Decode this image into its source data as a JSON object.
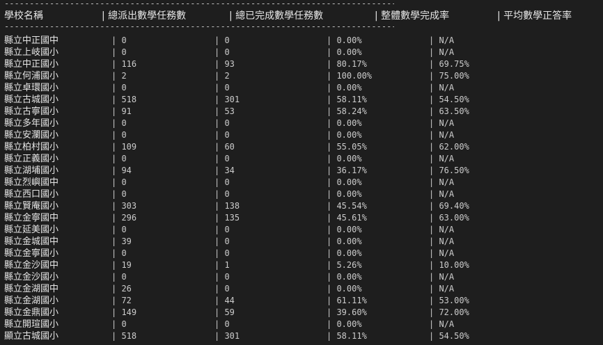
{
  "rule_top": "----------------------------------------------------------------------------------",
  "rule_bottom": "----------------------------------------------------------------------------------",
  "headers": {
    "school": "學校名稱",
    "assigned": "| 總派出數學任務數",
    "completed": "| 總已完成數學任務數",
    "completion_rate": "| 整體數學完成率",
    "accuracy": "| 平均數學正答率"
  },
  "rows": [
    {
      "school": "縣立中正國中",
      "assigned": "| 0",
      "completed": "| 0",
      "completion_rate": "| 0.00%",
      "accuracy": "| N/A"
    },
    {
      "school": "縣立上岐國小",
      "assigned": "| 0",
      "completed": "| 0",
      "completion_rate": "| 0.00%",
      "accuracy": "| N/A"
    },
    {
      "school": "縣立中正國小",
      "assigned": "| 116",
      "completed": "| 93",
      "completion_rate": "| 80.17%",
      "accuracy": "| 69.75%"
    },
    {
      "school": "縣立何浦國小",
      "assigned": "| 2",
      "completed": "| 2",
      "completion_rate": "| 100.00%",
      "accuracy": "| 75.00%"
    },
    {
      "school": "縣立卓環國小",
      "assigned": "| 0",
      "completed": "| 0",
      "completion_rate": "| 0.00%",
      "accuracy": "| N/A"
    },
    {
      "school": "縣立古城國小",
      "assigned": "| 518",
      "completed": "| 301",
      "completion_rate": "| 58.11%",
      "accuracy": "| 54.50%"
    },
    {
      "school": "縣立古寧國小",
      "assigned": "| 91",
      "completed": "| 53",
      "completion_rate": "| 58.24%",
      "accuracy": "| 63.50%"
    },
    {
      "school": "縣立多年國小",
      "assigned": "| 0",
      "completed": "| 0",
      "completion_rate": "| 0.00%",
      "accuracy": "| N/A"
    },
    {
      "school": "縣立安瀾國小",
      "assigned": "| 0",
      "completed": "| 0",
      "completion_rate": "| 0.00%",
      "accuracy": "| N/A"
    },
    {
      "school": "縣立柏村國小",
      "assigned": "| 109",
      "completed": "| 60",
      "completion_rate": "| 55.05%",
      "accuracy": "| 62.00%"
    },
    {
      "school": "縣立正義國小",
      "assigned": "| 0",
      "completed": "| 0",
      "completion_rate": "| 0.00%",
      "accuracy": "| N/A"
    },
    {
      "school": "縣立湖埔國小",
      "assigned": "| 94",
      "completed": "| 34",
      "completion_rate": "| 36.17%",
      "accuracy": "| 76.50%"
    },
    {
      "school": "縣立烈嶼國中",
      "assigned": "| 0",
      "completed": "| 0",
      "completion_rate": "| 0.00%",
      "accuracy": "| N/A"
    },
    {
      "school": "縣立西口國小",
      "assigned": "| 0",
      "completed": "| 0",
      "completion_rate": "| 0.00%",
      "accuracy": "| N/A"
    },
    {
      "school": "縣立賢庵國小",
      "assigned": "| 303",
      "completed": "| 138",
      "completion_rate": "| 45.54%",
      "accuracy": "| 69.40%"
    },
    {
      "school": "縣立金寧國中",
      "assigned": "| 296",
      "completed": "| 135",
      "completion_rate": "| 45.61%",
      "accuracy": "| 63.00%"
    },
    {
      "school": "縣立延美國小",
      "assigned": "| 0",
      "completed": "| 0",
      "completion_rate": "| 0.00%",
      "accuracy": "| N/A"
    },
    {
      "school": "縣立金城國中",
      "assigned": "| 39",
      "completed": "| 0",
      "completion_rate": "| 0.00%",
      "accuracy": "| N/A"
    },
    {
      "school": "縣立金寧國小",
      "assigned": "| 0",
      "completed": "| 0",
      "completion_rate": "| 0.00%",
      "accuracy": "| N/A"
    },
    {
      "school": "縣立金沙國中",
      "assigned": "| 19",
      "completed": "| 1",
      "completion_rate": "| 5.26%",
      "accuracy": "| 10.00%"
    },
    {
      "school": "縣立金沙國小",
      "assigned": "| 0",
      "completed": "| 0",
      "completion_rate": "| 0.00%",
      "accuracy": "| N/A"
    },
    {
      "school": "縣立金湖國中",
      "assigned": "| 26",
      "completed": "| 0",
      "completion_rate": "| 0.00%",
      "accuracy": "| N/A"
    },
    {
      "school": "縣立金湖國小",
      "assigned": "| 72",
      "completed": "| 44",
      "completion_rate": "| 61.11%",
      "accuracy": "| 53.00%"
    },
    {
      "school": "縣立金鼎國小",
      "assigned": "| 149",
      "completed": "| 59",
      "completion_rate": "| 39.60%",
      "accuracy": "| 72.00%"
    },
    {
      "school": "縣立開瑄國小",
      "assigned": "| 0",
      "completed": "| 0",
      "completion_rate": "| 0.00%",
      "accuracy": "| N/A"
    },
    {
      "school": "顯立古城國小",
      "assigned": "| 518",
      "completed": "| 301",
      "completion_rate": "| 58.11%",
      "accuracy": "| 54.50%"
    }
  ]
}
